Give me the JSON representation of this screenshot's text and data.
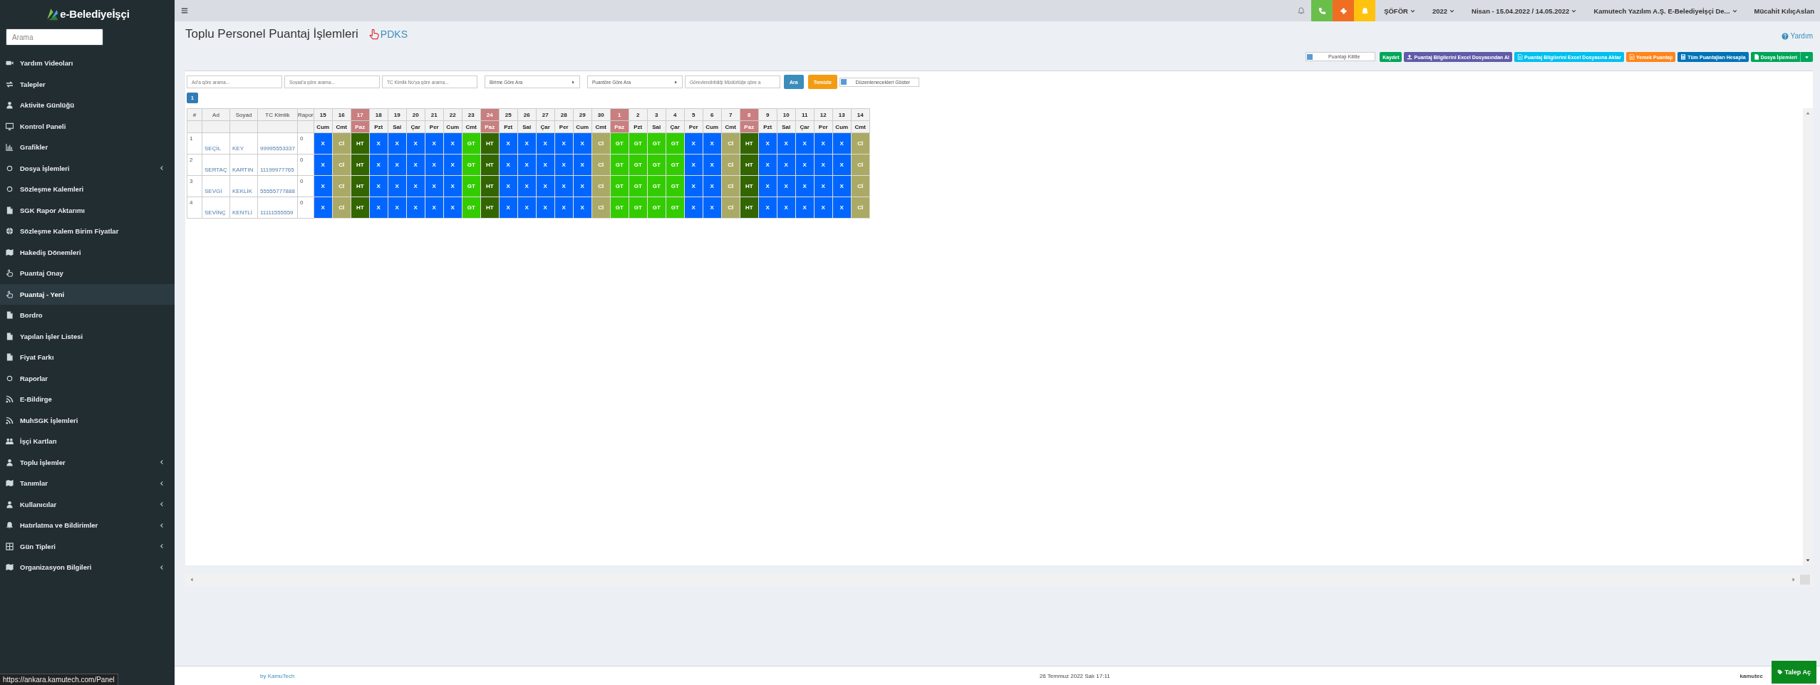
{
  "sidebar": {
    "logo": "e-Belediyeİşçi",
    "search": {
      "placeholder": "Arama"
    },
    "items": [
      {
        "label": "Yardım Videoları",
        "kind": "video",
        "expandable": false,
        "selected": false
      },
      {
        "label": "Talepler",
        "kind": "exchange",
        "expandable": false,
        "selected": false
      },
      {
        "label": "Aktivite Günlüğü",
        "kind": "user",
        "expandable": false,
        "selected": false
      },
      {
        "label": "Kontrol Paneli",
        "kind": "monitor",
        "expandable": false,
        "selected": false
      },
      {
        "label": "Grafikler",
        "kind": "chart",
        "expandable": false,
        "selected": false
      },
      {
        "label": "Dosya İşlemleri",
        "kind": "circle",
        "expandable": true,
        "selected": false
      },
      {
        "label": "Sözleşme Kalemleri",
        "kind": "circle",
        "expandable": false,
        "selected": false
      },
      {
        "label": "SGK Rapor Aktarımı",
        "kind": "doc",
        "expandable": false,
        "selected": false
      },
      {
        "label": "Sözleşme Kalem Birim Fiyatlar",
        "kind": "globe",
        "expandable": false,
        "selected": false
      },
      {
        "label": "Hakediş Dönemleri",
        "kind": "map",
        "expandable": false,
        "selected": false
      },
      {
        "label": "Puantaj Onay",
        "kind": "hand",
        "expandable": false,
        "selected": false
      },
      {
        "label": "Puantaj - Yeni",
        "kind": "hand",
        "expandable": false,
        "selected": true
      },
      {
        "label": "Bordro",
        "kind": "doc",
        "expandable": false,
        "selected": false
      },
      {
        "label": "Yapılan İşler Listesi",
        "kind": "doc",
        "expandable": false,
        "selected": false
      },
      {
        "label": "Fiyat Farkı",
        "kind": "doc",
        "expandable": false,
        "selected": false
      },
      {
        "label": "Raporlar",
        "kind": "circle",
        "expandable": false,
        "selected": false
      },
      {
        "label": "E-Bildirge",
        "kind": "rss",
        "expandable": false,
        "selected": false
      },
      {
        "label": "MuhSGK İşlemleri",
        "kind": "rss",
        "expandable": false,
        "selected": false
      },
      {
        "label": "İşçi Kartları",
        "kind": "users",
        "expandable": false,
        "selected": false
      },
      {
        "label": "Toplu İşlemler",
        "kind": "user",
        "expandable": true,
        "selected": false
      },
      {
        "label": "Tanımlar",
        "kind": "map",
        "expandable": true,
        "selected": false
      },
      {
        "label": "Kullanıcılar",
        "kind": "user",
        "expandable": true,
        "selected": false
      },
      {
        "label": "Hatırlatma ve Bildirimler",
        "kind": "bell",
        "expandable": true,
        "selected": false
      },
      {
        "label": "Gün Tipleri",
        "kind": "grid",
        "expandable": true,
        "selected": false
      },
      {
        "label": "Organizasyon Bilgileri",
        "kind": "map",
        "expandable": true,
        "selected": false
      }
    ]
  },
  "topbar": {
    "tiles": [
      {
        "kind": "phone",
        "color": "#6abf4b"
      },
      {
        "kind": "ticket",
        "color": "#f06e22"
      },
      {
        "kind": "bell",
        "color": "#ffc20e"
      }
    ],
    "dropdowns": [
      {
        "label": "ŞÖFÖR"
      },
      {
        "label": "2022"
      },
      {
        "label": "Nisan - 15.04.2022 / 14.05.2022"
      },
      {
        "label": "Kamutech Yazılım A.Ş. E-Belediyeİşçi De..."
      }
    ],
    "user_name": "Mücahit KılıçAslan"
  },
  "page": {
    "title": "Toplu Personel Puantaj İşlemleri",
    "pdks_link": "PDKS",
    "help_link": "Yardım"
  },
  "toolbar": {
    "lock_toggle": {
      "label": "Puantajı Kilitle",
      "checked": false
    },
    "buttons": [
      {
        "label": "Kaydet",
        "kind": "plain",
        "color": "#00a65a"
      },
      {
        "label": "Puantaj Bilgilerini Excel Dosyasından Al",
        "kind": "upload",
        "color": "#605ca8"
      },
      {
        "label": "Puantaj Bilgilerini Excel Dosyasına Aktar",
        "kind": "excel",
        "color": "#00c0ef"
      },
      {
        "label": "Yemek Puantajı",
        "kind": "excel",
        "color": "#ff851b"
      },
      {
        "label": "Tüm Puantajları Hesapla",
        "kind": "calc",
        "color": "#0073b7"
      },
      {
        "label": "Dosya İşlemleri",
        "kind": "split",
        "color": "#00a65a"
      }
    ]
  },
  "filters": {
    "fields": [
      {
        "kind": "input",
        "placeholder": "Ad'a göre arama..."
      },
      {
        "kind": "input",
        "placeholder": "Soyad'a göre arama..."
      },
      {
        "kind": "input",
        "placeholder": "TC Kimlik No'ya göre arama..."
      },
      {
        "kind": "select",
        "placeholder": "Birime Göre Ara"
      },
      {
        "kind": "select",
        "placeholder": "Puantöre Göre Ara"
      },
      {
        "kind": "input",
        "placeholder": "Görevlendirildiği Müdürlüğe göre a"
      }
    ],
    "search_button": "Ara",
    "clear_button": "Temizle",
    "edit_toggle": {
      "label": "Düzenlenecekleri Göster",
      "checked": false
    }
  },
  "pagination": [
    {
      "label": "1",
      "selected": true
    }
  ],
  "table": {
    "columns": [
      "#",
      "Ad",
      "Soyad",
      "TC Kimlik",
      "Rapor"
    ],
    "days": [
      {
        "num": "15",
        "dow": "Cum",
        "holiday": false
      },
      {
        "num": "16",
        "dow": "Cmt",
        "holiday": false
      },
      {
        "num": "17",
        "dow": "Paz",
        "holiday": true
      },
      {
        "num": "18",
        "dow": "Pzt",
        "holiday": false
      },
      {
        "num": "19",
        "dow": "Sal",
        "holiday": false
      },
      {
        "num": "20",
        "dow": "Çar",
        "holiday": false
      },
      {
        "num": "21",
        "dow": "Per",
        "holiday": false
      },
      {
        "num": "22",
        "dow": "Cum",
        "holiday": false
      },
      {
        "num": "23",
        "dow": "Cmt",
        "holiday": false
      },
      {
        "num": "24",
        "dow": "Paz",
        "holiday": true
      },
      {
        "num": "25",
        "dow": "Pzt",
        "holiday": false
      },
      {
        "num": "26",
        "dow": "Sal",
        "holiday": false
      },
      {
        "num": "27",
        "dow": "Çar",
        "holiday": false
      },
      {
        "num": "28",
        "dow": "Per",
        "holiday": false
      },
      {
        "num": "29",
        "dow": "Cum",
        "holiday": false
      },
      {
        "num": "30",
        "dow": "Cmt",
        "holiday": false
      },
      {
        "num": "1",
        "dow": "Paz",
        "holiday": true
      },
      {
        "num": "2",
        "dow": "Pzt",
        "holiday": false
      },
      {
        "num": "3",
        "dow": "Sal",
        "holiday": false
      },
      {
        "num": "4",
        "dow": "Çar",
        "holiday": false
      },
      {
        "num": "5",
        "dow": "Per",
        "holiday": false
      },
      {
        "num": "6",
        "dow": "Cum",
        "holiday": false
      },
      {
        "num": "7",
        "dow": "Cmt",
        "holiday": false
      },
      {
        "num": "8",
        "dow": "Paz",
        "holiday": true
      },
      {
        "num": "9",
        "dow": "Pzt",
        "holiday": false
      },
      {
        "num": "10",
        "dow": "Sal",
        "holiday": false
      },
      {
        "num": "11",
        "dow": "Çar",
        "holiday": false
      },
      {
        "num": "12",
        "dow": "Per",
        "holiday": false
      },
      {
        "num": "13",
        "dow": "Cum",
        "holiday": false
      },
      {
        "num": "14",
        "dow": "Cmt",
        "holiday": false
      }
    ],
    "rows": [
      {
        "no": "1",
        "ad": "SEÇİL",
        "soyad": "KEY",
        "tc": "99995553337",
        "rapor": "0",
        "cells": [
          {
            "code": "X",
            "kind": "work"
          },
          {
            "code": "Cİ",
            "kind": "leave"
          },
          {
            "code": "HT",
            "kind": "weekly"
          },
          {
            "code": "X",
            "kind": "work"
          },
          {
            "code": "X",
            "kind": "work"
          },
          {
            "code": "X",
            "kind": "work"
          },
          {
            "code": "X",
            "kind": "work"
          },
          {
            "code": "X",
            "kind": "work"
          },
          {
            "code": "GT",
            "kind": "general"
          },
          {
            "code": "HT",
            "kind": "weekly"
          },
          {
            "code": "X",
            "kind": "work"
          },
          {
            "code": "X",
            "kind": "work"
          },
          {
            "code": "X",
            "kind": "work"
          },
          {
            "code": "X",
            "kind": "work"
          },
          {
            "code": "X",
            "kind": "work"
          },
          {
            "code": "Cİ",
            "kind": "leave"
          },
          {
            "code": "GT",
            "kind": "general"
          },
          {
            "code": "GT",
            "kind": "general"
          },
          {
            "code": "GT",
            "kind": "general"
          },
          {
            "code": "GT",
            "kind": "general"
          },
          {
            "code": "X",
            "kind": "work"
          },
          {
            "code": "X",
            "kind": "work"
          },
          {
            "code": "Cİ",
            "kind": "leave"
          },
          {
            "code": "HT",
            "kind": "weekly"
          },
          {
            "code": "X",
            "kind": "work"
          },
          {
            "code": "X",
            "kind": "work"
          },
          {
            "code": "X",
            "kind": "work"
          },
          {
            "code": "X",
            "kind": "work"
          },
          {
            "code": "X",
            "kind": "work"
          },
          {
            "code": "Cİ",
            "kind": "leave"
          }
        ]
      },
      {
        "no": "2",
        "ad": "SERTAÇ",
        "soyad": "KARTIN",
        "tc": "11199977765",
        "rapor": "0",
        "cells": [
          {
            "code": "X",
            "kind": "work"
          },
          {
            "code": "Cİ",
            "kind": "leave"
          },
          {
            "code": "HT",
            "kind": "weekly"
          },
          {
            "code": "X",
            "kind": "work"
          },
          {
            "code": "X",
            "kind": "work"
          },
          {
            "code": "X",
            "kind": "work"
          },
          {
            "code": "X",
            "kind": "work"
          },
          {
            "code": "X",
            "kind": "work"
          },
          {
            "code": "GT",
            "kind": "general"
          },
          {
            "code": "HT",
            "kind": "weekly"
          },
          {
            "code": "X",
            "kind": "work"
          },
          {
            "code": "X",
            "kind": "work"
          },
          {
            "code": "X",
            "kind": "work"
          },
          {
            "code": "X",
            "kind": "work"
          },
          {
            "code": "X",
            "kind": "work"
          },
          {
            "code": "Cİ",
            "kind": "leave"
          },
          {
            "code": "GT",
            "kind": "general"
          },
          {
            "code": "GT",
            "kind": "general"
          },
          {
            "code": "GT",
            "kind": "general"
          },
          {
            "code": "GT",
            "kind": "general"
          },
          {
            "code": "X",
            "kind": "work"
          },
          {
            "code": "X",
            "kind": "work"
          },
          {
            "code": "Cİ",
            "kind": "leave"
          },
          {
            "code": "HT",
            "kind": "weekly"
          },
          {
            "code": "X",
            "kind": "work"
          },
          {
            "code": "X",
            "kind": "work"
          },
          {
            "code": "X",
            "kind": "work"
          },
          {
            "code": "X",
            "kind": "work"
          },
          {
            "code": "X",
            "kind": "work"
          },
          {
            "code": "Cİ",
            "kind": "leave"
          }
        ]
      },
      {
        "no": "3",
        "ad": "SEVGİ",
        "soyad": "KEKLİK",
        "tc": "55555777888",
        "rapor": "0",
        "cells": [
          {
            "code": "X",
            "kind": "work"
          },
          {
            "code": "Cİ",
            "kind": "leave"
          },
          {
            "code": "HT",
            "kind": "weekly"
          },
          {
            "code": "X",
            "kind": "work"
          },
          {
            "code": "X",
            "kind": "work"
          },
          {
            "code": "X",
            "kind": "work"
          },
          {
            "code": "X",
            "kind": "work"
          },
          {
            "code": "X",
            "kind": "work"
          },
          {
            "code": "GT",
            "kind": "general"
          },
          {
            "code": "HT",
            "kind": "weekly"
          },
          {
            "code": "X",
            "kind": "work"
          },
          {
            "code": "X",
            "kind": "work"
          },
          {
            "code": "X",
            "kind": "work"
          },
          {
            "code": "X",
            "kind": "work"
          },
          {
            "code": "X",
            "kind": "work"
          },
          {
            "code": "Cİ",
            "kind": "leave"
          },
          {
            "code": "GT",
            "kind": "general"
          },
          {
            "code": "GT",
            "kind": "general"
          },
          {
            "code": "GT",
            "kind": "general"
          },
          {
            "code": "GT",
            "kind": "general"
          },
          {
            "code": "X",
            "kind": "work"
          },
          {
            "code": "X",
            "kind": "work"
          },
          {
            "code": "Cİ",
            "kind": "leave"
          },
          {
            "code": "HT",
            "kind": "weekly"
          },
          {
            "code": "X",
            "kind": "work"
          },
          {
            "code": "X",
            "kind": "work"
          },
          {
            "code": "X",
            "kind": "work"
          },
          {
            "code": "X",
            "kind": "work"
          },
          {
            "code": "X",
            "kind": "work"
          },
          {
            "code": "Cİ",
            "kind": "leave"
          }
        ]
      },
      {
        "no": "4",
        "ad": "SEVİNÇ",
        "soyad": "KENTLİ",
        "tc": "11111555559",
        "rapor": "0",
        "cells": [
          {
            "code": "X",
            "kind": "work"
          },
          {
            "code": "Cİ",
            "kind": "leave"
          },
          {
            "code": "HT",
            "kind": "weekly"
          },
          {
            "code": "X",
            "kind": "work"
          },
          {
            "code": "X",
            "kind": "work"
          },
          {
            "code": "X",
            "kind": "work"
          },
          {
            "code": "X",
            "kind": "work"
          },
          {
            "code": "X",
            "kind": "work"
          },
          {
            "code": "GT",
            "kind": "general"
          },
          {
            "code": "HT",
            "kind": "weekly"
          },
          {
            "code": "X",
            "kind": "work"
          },
          {
            "code": "X",
            "kind": "work"
          },
          {
            "code": "X",
            "kind": "work"
          },
          {
            "code": "X",
            "kind": "work"
          },
          {
            "code": "X",
            "kind": "work"
          },
          {
            "code": "Cİ",
            "kind": "leave"
          },
          {
            "code": "GT",
            "kind": "general"
          },
          {
            "code": "GT",
            "kind": "general"
          },
          {
            "code": "GT",
            "kind": "general"
          },
          {
            "code": "GT",
            "kind": "general"
          },
          {
            "code": "X",
            "kind": "work"
          },
          {
            "code": "X",
            "kind": "work"
          },
          {
            "code": "Cİ",
            "kind": "leave"
          },
          {
            "code": "HT",
            "kind": "weekly"
          },
          {
            "code": "X",
            "kind": "work"
          },
          {
            "code": "X",
            "kind": "work"
          },
          {
            "code": "X",
            "kind": "work"
          },
          {
            "code": "X",
            "kind": "work"
          },
          {
            "code": "X",
            "kind": "work"
          },
          {
            "code": "Cİ",
            "kind": "leave"
          }
        ]
      }
    ]
  },
  "footer": {
    "credit": "by KamuTech",
    "date": "26 Temmuz 2022 Salı 17:11",
    "right_text": "kamutec"
  },
  "status_url": "https://ankara.kamutech.com/Panel",
  "request_button": "Talep Aç"
}
